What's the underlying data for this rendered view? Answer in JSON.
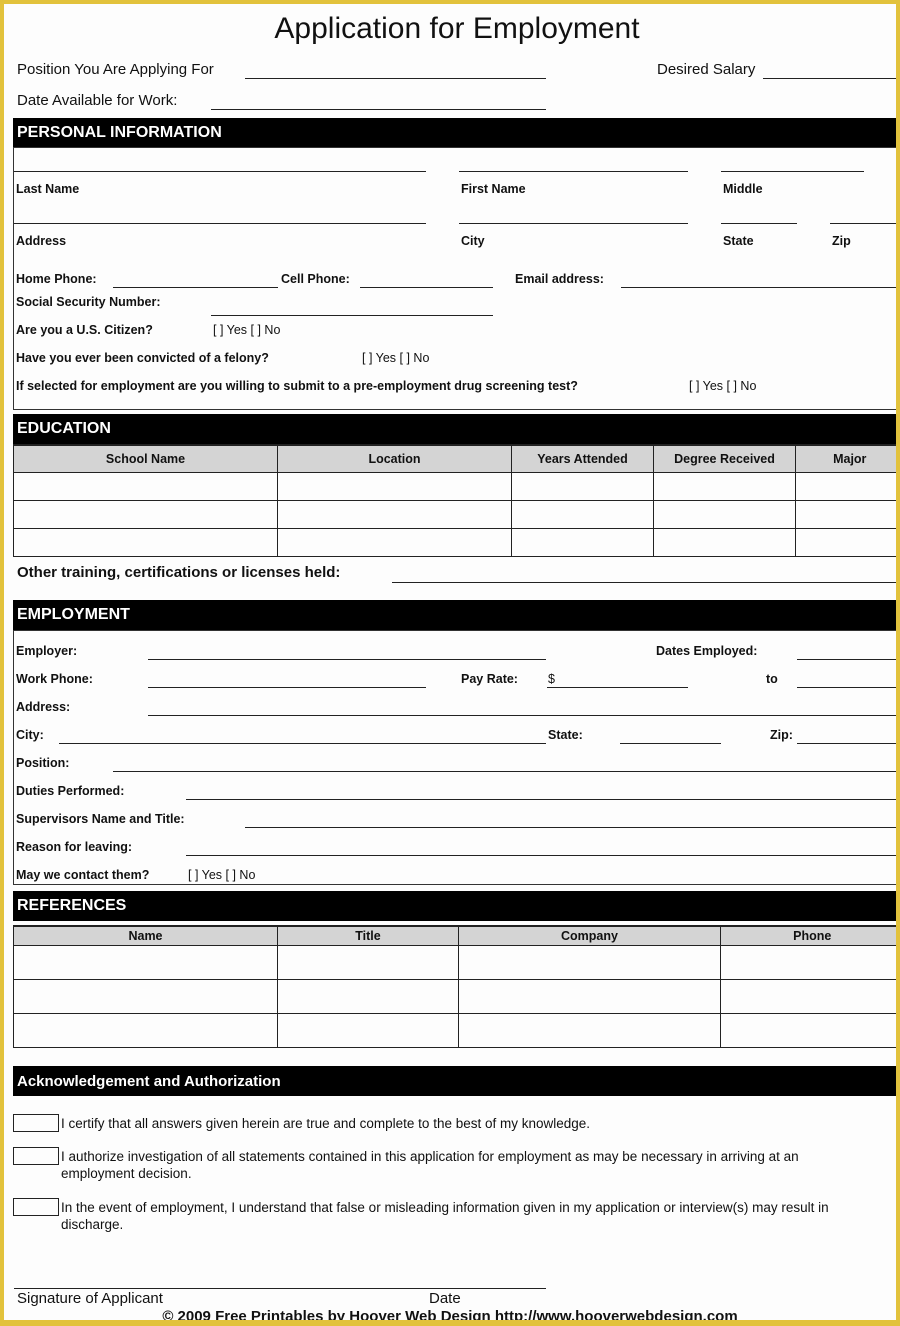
{
  "document": {
    "title": "Application for Employment",
    "frame_color": "#e2c23c",
    "header_fields": {
      "position": "Position You Are Applying For",
      "salary": "Desired Salary",
      "date_available": "Date Available for Work:"
    }
  },
  "personal": {
    "heading": "PERSONAL INFORMATION",
    "last_name": "Last Name",
    "first_name": "First Name",
    "middle": "Middle",
    "address": "Address",
    "city": "City",
    "state": "State",
    "zip": "Zip",
    "home_phone": "Home Phone:",
    "cell_phone": "Cell Phone:",
    "email": "Email address:",
    "ssn": "Social Security Number:",
    "citizen_q": "Are you a U.S. Citizen?",
    "felony_q": "Have you ever been convicted of a felony?",
    "drug_q": "If selected for employment are you willing to submit to a pre-employment drug screening test?",
    "yes_no": "[ ]  Yes [ ]  No"
  },
  "education": {
    "heading": "EDUCATION",
    "columns": [
      "School Name",
      "Location",
      "Years Attended",
      "Degree Received",
      "Major"
    ],
    "rows": [
      [
        "",
        "",
        "",
        "",
        ""
      ],
      [
        "",
        "",
        "",
        "",
        ""
      ],
      [
        "",
        "",
        "",
        "",
        ""
      ]
    ],
    "other_training": "Other training, certifications or licenses held:"
  },
  "employment": {
    "heading": "EMPLOYMENT",
    "employer": "Employer:",
    "dates_employed": "Dates Employed:",
    "work_phone": "Work Phone:",
    "pay_rate": "Pay Rate:",
    "currency": "$",
    "to": "to",
    "address": "Address:",
    "city": "City:",
    "state": "State:",
    "zip": "Zip:",
    "position": "Position:",
    "duties": "Duties Performed:",
    "supervisor": "Supervisors Name and Title:",
    "reason": "Reason for leaving:",
    "contact_q": "May we contact them?",
    "yes_no": "[ ]  Yes [ ]  No"
  },
  "references": {
    "heading": "REFERENCES",
    "columns": [
      "Name",
      "Title",
      "Company",
      "Phone"
    ],
    "rows": [
      [
        "",
        "",
        "",
        ""
      ],
      [
        "",
        "",
        "",
        ""
      ],
      [
        "",
        "",
        "",
        ""
      ]
    ]
  },
  "acknowledgement": {
    "heading": "Acknowledgement and Authorization",
    "items": [
      "I certify that all answers given herein are true and complete to the best of my knowledge.",
      "I authorize investigation of all statements contained in this application for employment as may be necessary in arriving at an employment decision.",
      "In the event of employment, I understand that false or misleading information given in my application or interview(s) may result in discharge."
    ]
  },
  "signature": {
    "signature_label": "Signature of  Applicant",
    "date_label": "Date"
  },
  "footer": {
    "text": "© 2009 Free Printables by Hoover Web Design http://www.hooverwebdesign.com"
  }
}
